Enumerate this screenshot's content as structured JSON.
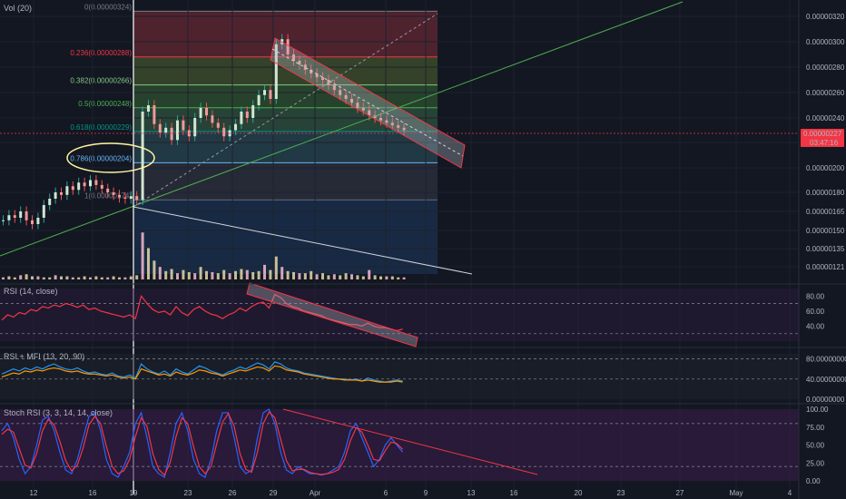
{
  "chart_data": [
    {
      "type": "candlestick",
      "title": "Vol (20)",
      "price_axis_ticks": [
        "0.00000320",
        "0.00000300",
        "0.00000280",
        "0.00000260",
        "0.00000240",
        "0.00000220",
        "0.00000200",
        "0.00000180",
        "0.00000165",
        "0.00000150",
        "0.00000135",
        "0.00000121"
      ],
      "price_axis_values": [
        320,
        300,
        280,
        260,
        240,
        220,
        200,
        180,
        165,
        150,
        135,
        121
      ],
      "current_price": "0.00000227",
      "countdown": "03:47:16",
      "fib_levels": [
        {
          "label": "0(0.00000324)",
          "ratio": 0,
          "value": 324,
          "color": "#787b86"
        },
        {
          "label": "0.236(0.00000288)",
          "ratio": 0.236,
          "value": 288,
          "color": "#f23645"
        },
        {
          "label": "0.382(0.00000266)",
          "ratio": 0.382,
          "value": 266,
          "color": "#81c784"
        },
        {
          "label": "0.5(0.00000248)",
          "ratio": 0.5,
          "value": 248,
          "color": "#4caf50"
        },
        {
          "label": "0.618(0.00000229)",
          "ratio": 0.618,
          "value": 229,
          "color": "#009688"
        },
        {
          "label": "0.786(0.00000204)",
          "ratio": 0.786,
          "value": 204,
          "color": "#64b5f6"
        },
        {
          "label": "1(0.00000174)",
          "ratio": 1,
          "value": 174,
          "color": "#787b86"
        }
      ],
      "x_ticks": [
        "12",
        "16",
        "19",
        "23",
        "26",
        "29",
        "Apr",
        "6",
        "9",
        "13",
        "16",
        "20",
        "23",
        "27",
        "May",
        "4"
      ],
      "close_series": [
        158,
        162,
        160,
        165,
        158,
        155,
        160,
        170,
        175,
        180,
        178,
        185,
        182,
        188,
        185,
        190,
        186,
        183,
        180,
        178,
        176,
        175,
        177,
        174,
        245,
        250,
        235,
        228,
        232,
        222,
        238,
        230,
        225,
        240,
        248,
        242,
        236,
        232,
        225,
        230,
        235,
        245,
        240,
        250,
        258,
        262,
        255,
        298,
        302,
        290,
        285,
        282,
        278,
        275,
        272,
        270,
        266,
        262,
        258,
        255,
        252,
        248,
        246,
        242,
        240,
        238,
        236,
        234,
        232,
        230
      ],
      "volume_series": [
        2,
        3,
        2,
        4,
        5,
        3,
        3,
        2,
        2,
        4,
        3,
        3,
        2,
        2,
        3,
        2,
        3,
        2,
        2,
        3,
        2,
        2,
        3,
        4,
        45,
        30,
        18,
        12,
        8,
        10,
        6,
        9,
        7,
        6,
        12,
        8,
        7,
        6,
        9,
        6,
        8,
        10,
        9,
        7,
        8,
        14,
        9,
        22,
        12,
        8,
        7,
        6,
        6,
        8,
        5,
        6,
        4,
        5,
        4,
        6,
        5,
        4,
        3,
        9,
        4,
        3,
        3,
        3,
        2,
        2
      ]
    },
    {
      "type": "line",
      "title": "RSI (14, close)",
      "axis_ticks": [
        "80.00",
        "60.00",
        "40.00"
      ],
      "axis_values": [
        80,
        60,
        40
      ],
      "values": [
        48,
        55,
        52,
        58,
        56,
        62,
        60,
        66,
        64,
        68,
        66,
        70,
        68,
        65,
        68,
        62,
        64,
        60,
        58,
        56,
        54,
        52,
        55,
        50,
        80,
        70,
        62,
        58,
        60,
        55,
        66,
        58,
        54,
        62,
        66,
        60,
        56,
        54,
        50,
        55,
        58,
        64,
        60,
        66,
        70,
        72,
        64,
        82,
        78,
        70,
        66,
        64,
        60,
        58,
        56,
        54,
        50,
        48,
        46,
        44,
        42,
        42,
        40,
        44,
        40,
        38,
        38,
        36,
        34,
        36
      ]
    },
    {
      "type": "line",
      "title": "RSI + MFI (13, 20, 90)",
      "axis_ticks": [
        "80.00000000",
        "40.00000000",
        "0.00000000"
      ],
      "axis_values": [
        80,
        40,
        0
      ],
      "series": [
        {
          "values": [
            50,
            55,
            60,
            56,
            62,
            58,
            64,
            60,
            66,
            70,
            64,
            60,
            58,
            62,
            56,
            52,
            54,
            50,
            48,
            52,
            46,
            44,
            48,
            42,
            70,
            60,
            54,
            50,
            56,
            48,
            60,
            54,
            50,
            58,
            66,
            62,
            56,
            52,
            48,
            54,
            58,
            64,
            60,
            66,
            72,
            68,
            60,
            74,
            70,
            62,
            58,
            56,
            52,
            50,
            48,
            46,
            44,
            42,
            40,
            40,
            38,
            40,
            36,
            42,
            38,
            36,
            34,
            36,
            38,
            36
          ]
        },
        {
          "values": [
            44,
            48,
            52,
            50,
            56,
            54,
            58,
            56,
            60,
            62,
            60,
            56,
            54,
            56,
            52,
            50,
            50,
            48,
            46,
            48,
            44,
            42,
            44,
            40,
            60,
            56,
            52,
            48,
            50,
            46,
            54,
            50,
            48,
            52,
            58,
            56,
            52,
            50,
            46,
            50,
            54,
            58,
            56,
            60,
            64,
            62,
            56,
            66,
            64,
            58,
            56,
            54,
            50,
            48,
            46,
            44,
            42,
            40,
            40,
            38,
            38,
            38,
            36,
            38,
            36,
            34,
            34,
            34,
            36,
            34
          ]
        }
      ]
    },
    {
      "type": "line",
      "title": "Stoch RSI (3, 3, 14, 14, close)",
      "axis_ticks": [
        "100.00",
        "75.00",
        "50.00",
        "25.00",
        "0.00"
      ],
      "axis_values": [
        100,
        75,
        50,
        25,
        0
      ],
      "series": [
        {
          "values": [
            70,
            80,
            60,
            30,
            10,
            20,
            50,
            85,
            90,
            70,
            40,
            15,
            10,
            30,
            60,
            90,
            95,
            70,
            30,
            10,
            5,
            20,
            40,
            80,
            95,
            60,
            20,
            10,
            5,
            40,
            80,
            95,
            70,
            30,
            10,
            5,
            30,
            70,
            95,
            95,
            60,
            20,
            10,
            15,
            60,
            95,
            100,
            80,
            40,
            15,
            10,
            20,
            15,
            10,
            10,
            8,
            10,
            15,
            20,
            40,
            70,
            80,
            60,
            40,
            20,
            30,
            50,
            60,
            50,
            40
          ]
        },
        {
          "values": [
            65,
            72,
            68,
            45,
            22,
            18,
            38,
            70,
            86,
            78,
            55,
            28,
            14,
            22,
            46,
            78,
            90,
            80,
            48,
            20,
            10,
            14,
            30,
            62,
            88,
            76,
            38,
            16,
            8,
            26,
            62,
            88,
            80,
            48,
            20,
            10,
            20,
            52,
            82,
            94,
            76,
            38,
            16,
            12,
            40,
            80,
            96,
            88,
            58,
            28,
            14,
            16,
            16,
            12,
            10,
            9,
            10,
            12,
            16,
            30,
            56,
            74,
            68,
            50,
            30,
            28,
            42,
            54,
            52,
            44
          ]
        }
      ]
    }
  ]
}
